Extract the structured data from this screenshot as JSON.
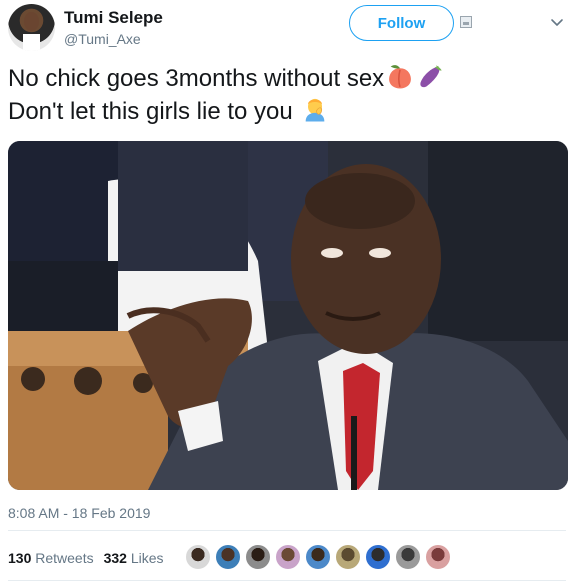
{
  "user": {
    "name": "Tumi Selepe",
    "handle": "@Tumi_Axe"
  },
  "header": {
    "follow_label": "Follow"
  },
  "tweet": {
    "line1": "No chick goes 3months without sex",
    "line2": "Don't let this girls lie to you"
  },
  "meta": {
    "timestamp": "8:08 AM - 18 Feb 2019"
  },
  "stats": {
    "retweets_count": "130",
    "retweets_label": "Retweets",
    "likes_count": "332",
    "likes_label": "Likes"
  },
  "icons": {
    "emoji_1": "peach-emoji",
    "emoji_2": "eggplant-emoji",
    "emoji_3": "person-facepalming-emoji"
  },
  "colors": {
    "accent": "#1da1f2",
    "secondary_text": "#657786",
    "primary_text": "#14171a"
  }
}
